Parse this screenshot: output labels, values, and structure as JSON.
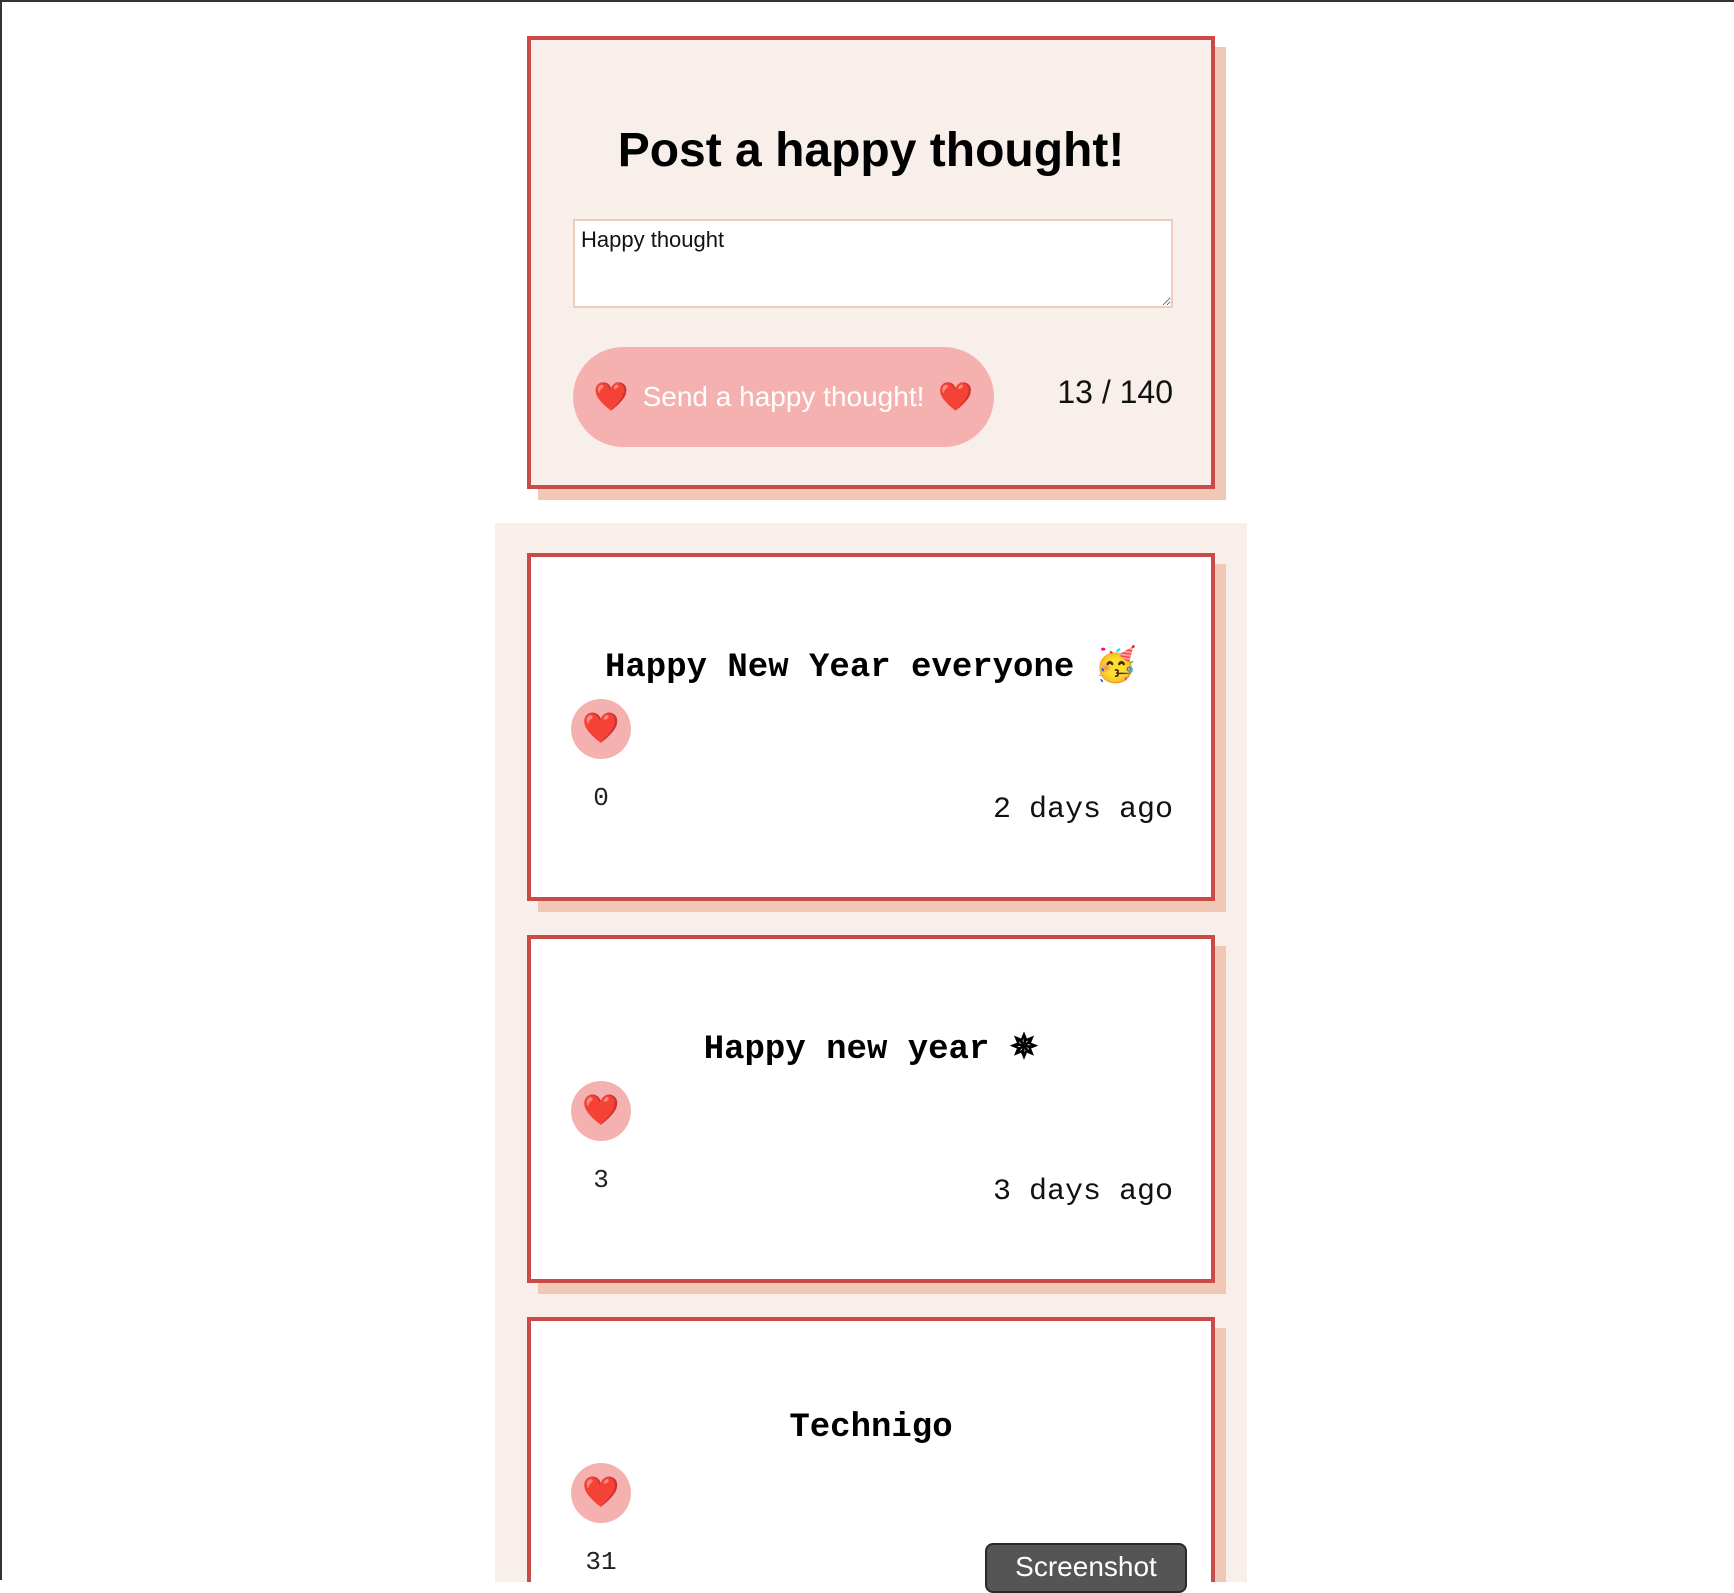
{
  "form": {
    "title": "Post a happy thought!",
    "input_value": "Happy thought",
    "send_label": "Send a happy thought!",
    "heart_icon": "❤️",
    "counter": "13 / 140"
  },
  "thoughts": [
    {
      "message": "Happy New Year everyone 🥳",
      "heart_icon": "❤️",
      "likes": "0",
      "time": "2 days ago"
    },
    {
      "message": "Happy new year ✵",
      "heart_icon": "❤️",
      "likes": "3",
      "time": "3 days ago"
    },
    {
      "message": "Technigo",
      "heart_icon": "❤️",
      "likes": "31",
      "time": ""
    }
  ],
  "overlay": {
    "screenshot_label": "Screenshot"
  },
  "colors": {
    "card_border": "#c94a46",
    "card_shadow": "#f0c8b5",
    "form_background": "#f9efea",
    "button_pink": "#f5b1b0",
    "heart_red": "#e0202a"
  }
}
